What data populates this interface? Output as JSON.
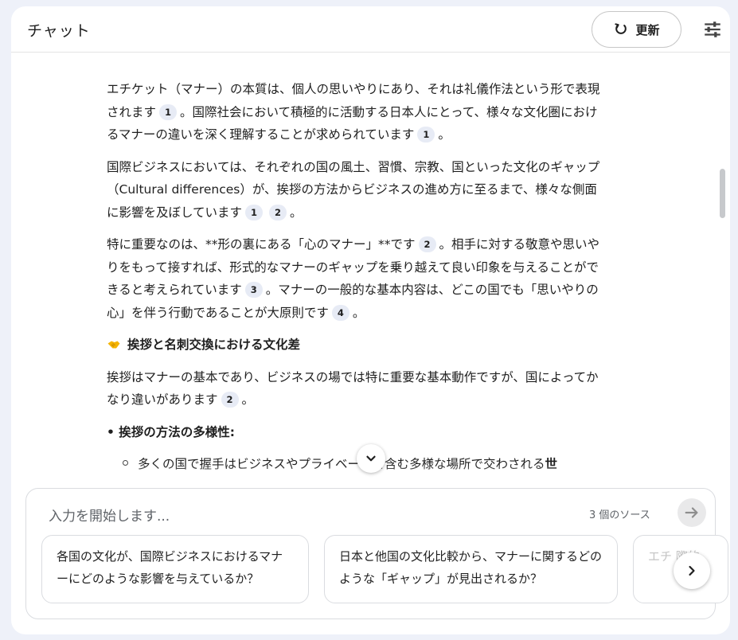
{
  "header": {
    "title": "チャット",
    "refresh_label": "更新"
  },
  "messages": {
    "p1": {
      "t1": "エチケット（マナー）の本質は、個人の思いやりにあり、それは礼儀作法という形で表現されます",
      "c1": "1",
      "t2": "。国際社会において積極的に活動する日本人にとって、様々な文化圏におけるマナーの違いを深く理解することが求められています",
      "c2": "1",
      "t3": "。"
    },
    "p2": {
      "t1": "国際ビジネスにおいては、それぞれの国の風土、習慣、宗教、国といった文化のギャップ（Cultural differences）が、挨拶の方法からビジネスの進め方に至るまで、様々な側面に影響を及ぼしています",
      "c1": "1",
      "c2": "2",
      "t2": "。"
    },
    "p3": {
      "t1": "特に重要なのは、**形の裏にある「心のマナー」**です",
      "c1": "2",
      "t2": "。相手に対する敬意や思いやりをもって接すれば、形式的なマナーのギャップを乗り越えて良い印象を与えることができると考えられています",
      "c2": "3",
      "t3": "。マナーの一般的な基本内容は、どこの国でも「思いやりの心」を伴う行動であることが大原則です",
      "c3": "4",
      "t4": "。"
    },
    "section_heading": "挨拶と名刺交換における文化差",
    "p4": {
      "t1": "挨拶はマナーの基本であり、ビジネスの場では特に重要な基本動作ですが、国によってかなり違いがあります",
      "c1": "2",
      "t2": "。"
    },
    "bullet_heading": "• 挨拶の方法の多様性:",
    "sub_item": {
      "t1": "多くの国で握手はビジネスやプライベートを含む多様な場所で交わされる",
      "bold": "世"
    }
  },
  "input": {
    "placeholder": "入力を開始します...",
    "source_count": "3 個のソース"
  },
  "suggestions": [
    "各国の文化が、国際ビジネスにおけるマナーにどのような影響を与えているか？",
    "日本と他国の文化比較から、マナーに関するどのような「ギャップ」が見出されるか？",
    "エチ 際的"
  ],
  "icons": {
    "refresh": "refresh-icon",
    "tune": "tune-icon",
    "send": "arrow-right-icon",
    "scroll_down": "chevron-down-icon",
    "next": "chevron-right-icon",
    "section": "handshake-icon"
  }
}
